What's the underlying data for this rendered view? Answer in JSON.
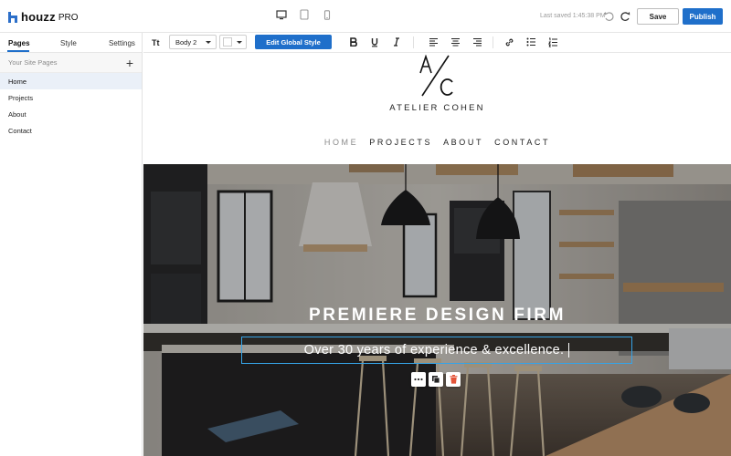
{
  "app": {
    "brand": "houzz",
    "product": "PRO",
    "saved_status": "Last saved 1:45:38 PM",
    "save_label": "Save",
    "publish_label": "Publish",
    "accent_color": "#1f6fca"
  },
  "devices": [
    "desktop-icon",
    "tablet-icon",
    "mobile-icon"
  ],
  "sidebar": {
    "tabs": [
      {
        "label": "Pages",
        "active": true
      },
      {
        "label": "Style",
        "active": false
      },
      {
        "label": "Settings",
        "active": false
      }
    ],
    "section_title": "Your Site Pages",
    "pages": [
      {
        "label": "Home",
        "selected": true
      },
      {
        "label": "Projects",
        "selected": false
      },
      {
        "label": "About",
        "selected": false
      },
      {
        "label": "Contact",
        "selected": false
      }
    ]
  },
  "format_bar": {
    "text_style_icon": "Tt",
    "style_value": "Body 2",
    "color_value": "#ffffff",
    "global_style_label": "Edit Global Style",
    "icons": [
      "bold-icon",
      "underline-icon",
      "italic-icon",
      "align-left-icon",
      "align-center-icon",
      "align-right-icon",
      "link-icon",
      "bullet-list-icon",
      "numbered-list-icon"
    ]
  },
  "site": {
    "logo_letters": "A/C",
    "name": "ATELIER COHEN",
    "nav": [
      {
        "label": "HOME",
        "current": true
      },
      {
        "label": "PROJECTS",
        "current": false
      },
      {
        "label": "ABOUT",
        "current": false
      },
      {
        "label": "CONTACT",
        "current": false
      }
    ],
    "hero_title": "PREMIERE DESIGN FIRM",
    "hero_subtitle": "Over 30 years of experience & excellence.",
    "selection_color": "#36a3e6",
    "block_actions": [
      "more-icon",
      "duplicate-icon",
      "delete-icon"
    ]
  }
}
